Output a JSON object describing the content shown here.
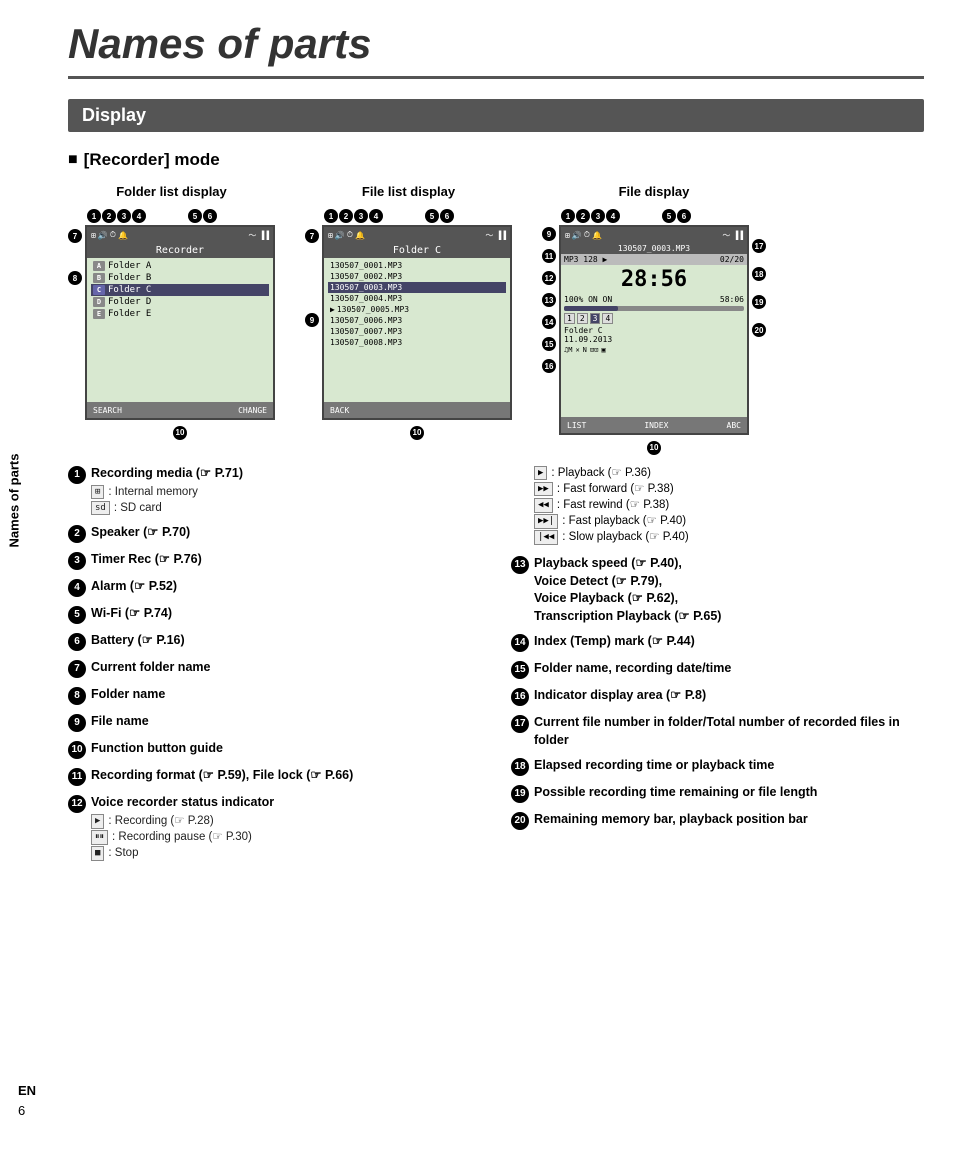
{
  "page": {
    "title": "Names of parts",
    "side_label": "Names of parts",
    "en_label": "EN",
    "page_number": "6"
  },
  "display_section": {
    "header": "Display",
    "mode_header": "[Recorder] mode",
    "screens": [
      {
        "title": "Folder list display",
        "top_icons_left": [
          "1",
          "2",
          "3",
          "4"
        ],
        "top_icons_right": [
          "5",
          "6"
        ],
        "screen_title": "Recorder",
        "folders": [
          {
            "icon": "A",
            "name": "Folder A",
            "selected": false
          },
          {
            "icon": "B",
            "name": "Folder B",
            "selected": false
          },
          {
            "icon": "C",
            "name": "Folder C",
            "selected": true
          },
          {
            "icon": "D",
            "name": "Folder D",
            "selected": false
          },
          {
            "icon": "E",
            "name": "Folder E",
            "selected": false
          }
        ],
        "bottom_left": "SEARCH",
        "bottom_right": "CHANGE",
        "left_annots": [
          "7",
          "8"
        ],
        "bottom_annot": "10"
      },
      {
        "title": "File list display",
        "top_icons_left": [
          "1",
          "2",
          "3",
          "4"
        ],
        "top_icons_right": [
          "5",
          "6"
        ],
        "screen_title": "Folder C",
        "files": [
          {
            "name": "130507_0001.MP3",
            "selected": false,
            "playing": false
          },
          {
            "name": "130507_0002.MP3",
            "selected": false,
            "playing": false
          },
          {
            "name": "130507_0003.MP3",
            "selected": true,
            "playing": false
          },
          {
            "name": "130507_0004.MP3",
            "selected": false,
            "playing": false
          },
          {
            "name": "130507_0005.MP3",
            "selected": false,
            "playing": true
          },
          {
            "name": "130507_0006.MP3",
            "selected": false,
            "playing": false
          },
          {
            "name": "130507_0007.MP3",
            "selected": false,
            "playing": false
          },
          {
            "name": "130507_0008.MP3",
            "selected": false,
            "playing": false
          }
        ],
        "bottom_left": "BACK",
        "left_annots": [
          "7",
          "9"
        ],
        "bottom_annot": "10"
      },
      {
        "title": "File display",
        "top_icons_left": [
          "1",
          "2",
          "3",
          "4"
        ],
        "top_icons_right": [
          "5",
          "6"
        ],
        "filename": "130507_0003.MP3",
        "format": "MP3 128",
        "file_num": "02/20",
        "time": "28:56",
        "progress_pct": 30,
        "remaining": "58:06",
        "folder": "Folder C",
        "date": "11.09.2013",
        "bottom_left": "LIST",
        "bottom_mid": "INDEX",
        "bottom_right": "ABC",
        "right_annots": [
          "17",
          "18",
          "19",
          "20"
        ],
        "left_annots": [
          "9",
          "11",
          "12",
          "13",
          "14",
          "15",
          "16"
        ],
        "bottom_annot": "10"
      }
    ]
  },
  "descriptions": {
    "left_col": [
      {
        "num": "1",
        "header": "Recording media (☞ P.71)",
        "sub_items": [
          {
            "icon": "⊞",
            "text": ": Internal memory"
          },
          {
            "icon": "sd",
            "text": ": SD card"
          }
        ]
      },
      {
        "num": "2",
        "header": "Speaker (☞ P.70)",
        "sub_items": []
      },
      {
        "num": "3",
        "header": "Timer Rec (☞ P.76)",
        "sub_items": []
      },
      {
        "num": "4",
        "header": "Alarm (☞ P.52)",
        "sub_items": []
      },
      {
        "num": "5",
        "header": "Wi-Fi (☞ P.74)",
        "sub_items": []
      },
      {
        "num": "6",
        "header": "Battery (☞ P.16)",
        "sub_items": []
      },
      {
        "num": "7",
        "header": "Current folder name",
        "sub_items": []
      },
      {
        "num": "8",
        "header": "Folder name",
        "sub_items": []
      },
      {
        "num": "9",
        "header": "File name",
        "sub_items": []
      },
      {
        "num": "10",
        "header": "Function button guide",
        "sub_items": []
      },
      {
        "num": "11",
        "header": "Recording format (☞ P.59), File lock (☞ P.66)",
        "sub_items": []
      },
      {
        "num": "12",
        "header": "Voice recorder status indicator",
        "sub_items": [
          {
            "icon": "▶",
            "text": ": Recording (☞ P.28)"
          },
          {
            "icon": "⏸",
            "text": ": Recording pause (☞ P.30)"
          },
          {
            "icon": "■",
            "text": ": Stop"
          }
        ]
      }
    ],
    "right_col": [
      {
        "num": "",
        "header": "",
        "intro": "playback_icons",
        "sub_items": [
          {
            "icon": "▶",
            "text": ": Playback (☞ P.36)"
          },
          {
            "icon": "▶▶",
            "text": ": Fast forward (☞ P.38)"
          },
          {
            "icon": "◀◀",
            "text": ": Fast rewind (☞ P.38)"
          },
          {
            "icon": "▶▶|",
            "text": ": Fast playback (☞ P.40)"
          },
          {
            "icon": "|◀◀",
            "text": ": Slow playback (☞ P.40)"
          }
        ]
      },
      {
        "num": "13",
        "header": "Playback speed (☞ P.40), Voice Detect (☞ P.79), Voice Playback (☞ P.62), Transcription Playback (☞ P.65)",
        "sub_items": []
      },
      {
        "num": "14",
        "header": "Index (Temp) mark (☞ P.44)",
        "sub_items": []
      },
      {
        "num": "15",
        "header": "Folder name, recording date/time",
        "sub_items": []
      },
      {
        "num": "16",
        "header": "Indicator display area (☞ P.8)",
        "sub_items": []
      },
      {
        "num": "17",
        "header": "Current file number in folder/Total number of recorded files in folder",
        "sub_items": []
      },
      {
        "num": "18",
        "header": "Elapsed recording time or playback time",
        "sub_items": []
      },
      {
        "num": "19",
        "header": "Possible recording time remaining or file length",
        "sub_items": []
      },
      {
        "num": "20",
        "header": "Remaining memory bar, playback position bar",
        "sub_items": []
      }
    ]
  }
}
